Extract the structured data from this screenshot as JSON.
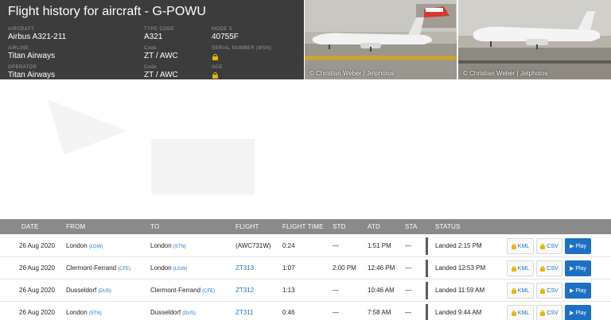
{
  "header": {
    "title": "Flight history for aircraft - G-POWU",
    "aircraft_label": "AIRCRAFT",
    "aircraft_value": "Airbus A321-211",
    "type_code_label": "TYPE CODE",
    "type_code_value": "A321",
    "mode_s_label": "MODE S",
    "mode_s_value": "40755F",
    "airline_label": "AIRLINE",
    "airline_value": "Titan Airways",
    "airline_code_label": "Code",
    "airline_code_value": "ZT / AWC",
    "serial_label": "SERIAL NUMBER (MSN)",
    "operator_label": "OPERATOR",
    "operator_value": "Titan Airways",
    "operator_code_label": "Code",
    "operator_code_value": "ZT / AWC",
    "age_label": "AGE"
  },
  "photos": [
    {
      "credit": "© Christian Weber | Jetphotos"
    },
    {
      "credit": "© Christian Weber | Jetphotos"
    }
  ],
  "table": {
    "columns": [
      "DATE",
      "FROM",
      "TO",
      "FLIGHT",
      "FLIGHT TIME",
      "STD",
      "ATD",
      "STA",
      "STATUS"
    ],
    "rows": [
      {
        "date": "26 Aug 2020",
        "from": "London",
        "from_code": "(LGW)",
        "to": "London",
        "to_code": "(STN)",
        "flight": "(AWC731W)",
        "flight_time": "0:24",
        "std": "—",
        "atd": "1:51 PM",
        "sta": "—",
        "status": "Landed 2:15 PM",
        "kml": "KML",
        "csv": "CSV",
        "play": "▶ Play"
      },
      {
        "date": "26 Aug 2020",
        "from": "Clermont-Ferrand",
        "from_code": "(CFE)",
        "to": "London",
        "to_code": "(LGW)",
        "flight": "ZT313",
        "flight_time": "1:07",
        "std": "2:00 PM",
        "atd": "12:46 PM",
        "sta": "—",
        "status": "Landed 12:53 PM",
        "kml": "KML",
        "csv": "CSV",
        "play": "▶ Play"
      },
      {
        "date": "26 Aug 2020",
        "from": "Dusseldorf",
        "from_code": "(DUS)",
        "to": "Clermont-Ferrand",
        "to_code": "(CFE)",
        "flight": "ZT312",
        "flight_time": "1:13",
        "std": "—",
        "atd": "10:46 AM",
        "sta": "—",
        "status": "Landed 11:59 AM",
        "kml": "KML",
        "csv": "CSV",
        "play": "▶ Play"
      },
      {
        "date": "26 Aug 2020",
        "from": "London",
        "from_code": "(STN)",
        "to": "Dusseldorf",
        "to_code": "(DUS)",
        "flight": "ZT311",
        "flight_time": "0:46",
        "std": "—",
        "atd": "7:58 AM",
        "sta": "—",
        "status": "Landed 9:44 AM",
        "kml": "KML",
        "csv": "CSV",
        "play": "▶ Play"
      }
    ]
  },
  "colors": {
    "header_bg": "#3c3c3c",
    "table_head_bg": "#8a8a8a",
    "link_blue": "#1a73c9",
    "play_blue": "#1c70c5",
    "lock_gold": "#e6b800"
  },
  "icons": [
    "lock-icon",
    "play-icon"
  ]
}
